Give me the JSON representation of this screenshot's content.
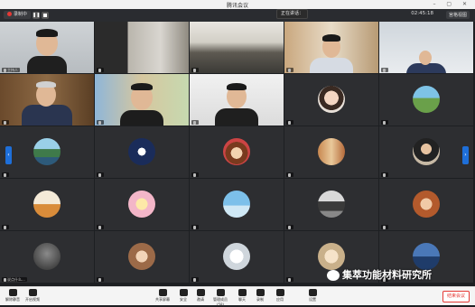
{
  "window": {
    "title": "腾讯会议"
  },
  "toolbar": {
    "recording_label": "录制中",
    "speaking_label": "正在讲话：",
    "timer": "02:45:18",
    "view_label": "宫格视图"
  },
  "tiles": [
    {
      "name": "主持人"
    },
    {
      "name": ""
    },
    {
      "name": ""
    },
    {
      "name": ""
    },
    {
      "name": ""
    },
    {
      "name": ""
    },
    {
      "name": ""
    },
    {
      "name": ""
    },
    {
      "name": ""
    },
    {
      "name": ""
    },
    {
      "name": ""
    },
    {
      "name": ""
    },
    {
      "name": ""
    },
    {
      "name": ""
    },
    {
      "name": ""
    },
    {
      "name": ""
    },
    {
      "name": ""
    },
    {
      "name": ""
    },
    {
      "name": ""
    },
    {
      "name": ""
    },
    {
      "name": "说点什么..."
    },
    {
      "name": ""
    },
    {
      "name": ""
    },
    {
      "name": ""
    },
    {
      "name": ""
    }
  ],
  "bottombar": {
    "mute_label": "解除静音",
    "video_label": "开启视频",
    "share_label": "共享屏幕",
    "security_label": "安全",
    "invite_label": "邀请",
    "members_label": "管理成员(58)",
    "chat_label": "聊天",
    "record_label": "录制",
    "apps_label": "应用",
    "more_label": "设置",
    "leave_label": "结束会议"
  },
  "watermark": {
    "text": "集萃功能材料研究所"
  },
  "colors": {
    "accent": "#1e6fd9",
    "danger": "#e53935",
    "tile_bg": "#2d2e31"
  }
}
